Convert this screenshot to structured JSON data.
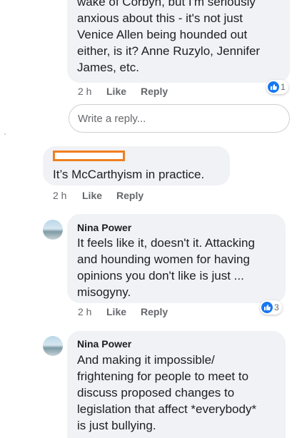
{
  "comment_1": {
    "text": "wake of Corbyn, but I'm seriously\nanxious about this - it's not just\nVenice Allen being hounded out\neither, is it? Anne Ruzylo, Jennifer\nJames, etc.",
    "time": "2 h",
    "like_label": "Like",
    "reply_label": "Reply",
    "reaction_count": "1"
  },
  "reply_box": {
    "placeholder": "Write a reply..."
  },
  "comment_2": {
    "text": "It’s McCarthyism in practice.",
    "time": "2 h",
    "like_label": "Like",
    "reply_label": "Reply"
  },
  "comment_3": {
    "author": "Nina Power",
    "text": "It feels like it, doesn't it. Attacking\nand hounding women for having\nopinions you don't like is just ...\nmisogyny.",
    "time": "2 h",
    "like_label": "Like",
    "reply_label": "Reply",
    "reaction_count": "3"
  },
  "comment_4": {
    "author": "Nina Power",
    "text": "And making it impossible/\nfrightening for people to meet to\ndiscuss proposed changes to\nlegislation that affect *everybody*\nis just bullying."
  },
  "colors": {
    "like_blue": "#1877f2",
    "redaction_orange": "#f07f1f",
    "bubble_gray": "#f0f2f5"
  },
  "icons": {
    "reaction": "thumbs-up-icon",
    "avatar": "profile-photo"
  }
}
